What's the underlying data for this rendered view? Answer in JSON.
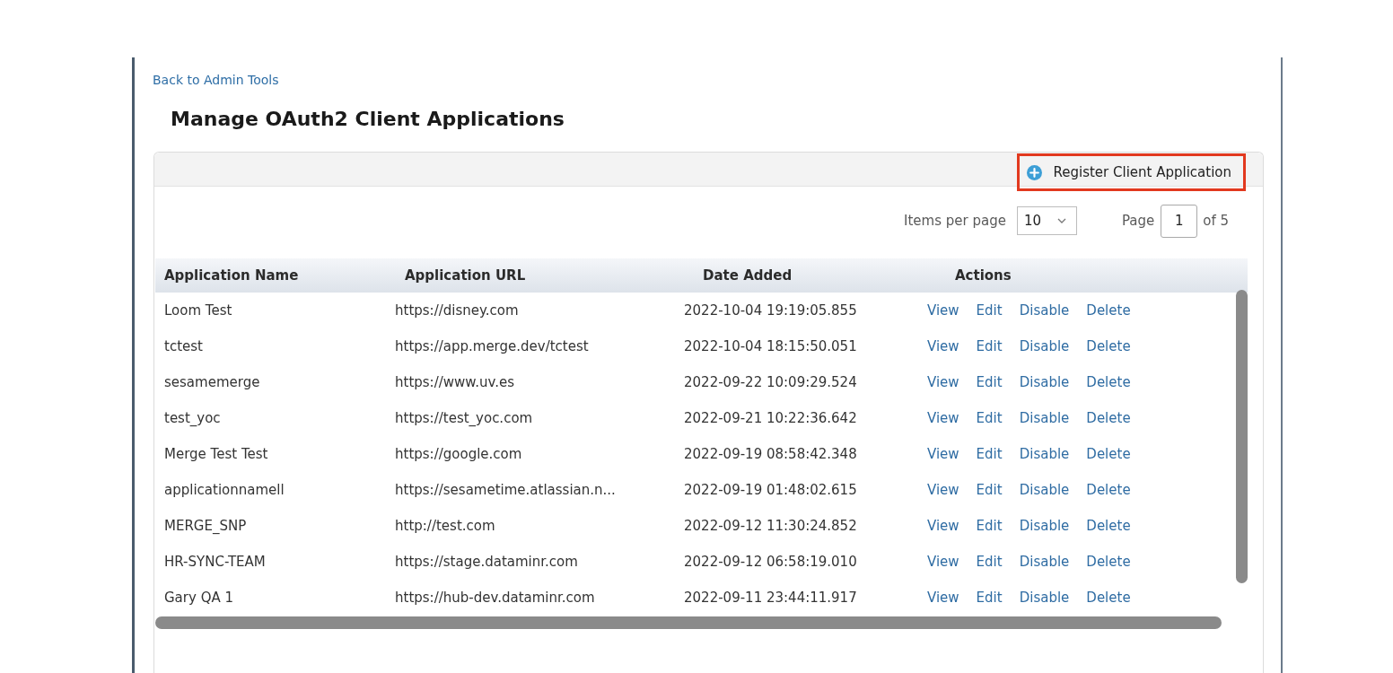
{
  "back_link": "Back to Admin Tools",
  "title": "Manage OAuth2 Client Applications",
  "toolbar": {
    "register_button": {
      "label": "Register Client Application",
      "highlighted": true
    }
  },
  "pagination": {
    "items_per_page_label": "Items per page",
    "items_per_page": "10",
    "page_label": "Page",
    "page": "1",
    "page_total": "of 5"
  },
  "table": {
    "columns": [
      "Application Name",
      "Application URL",
      "Date Added",
      "Actions"
    ],
    "rows": [
      {
        "name": "Loom Test",
        "url": "https://disney.com",
        "date_added": "2022-10-04 19:19:05.855",
        "actions": [
          "View",
          "Edit",
          "Disable",
          "Delete"
        ]
      },
      {
        "name": "tctest",
        "url": "https://app.merge.dev/tctest",
        "date_added": "2022-10-04 18:15:50.051",
        "actions": [
          "View",
          "Edit",
          "Disable",
          "Delete"
        ]
      },
      {
        "name": "sesamemerge",
        "url": "https://www.uv.es",
        "date_added": "2022-09-22 10:09:29.524",
        "actions": [
          "View",
          "Edit",
          "Disable",
          "Delete"
        ]
      },
      {
        "name": "test_yoc",
        "url": "https://test_yoc.com",
        "date_added": "2022-09-21 10:22:36.642",
        "actions": [
          "View",
          "Edit",
          "Disable",
          "Delete"
        ]
      },
      {
        "name": "Merge Test Test",
        "url": "https://google.com",
        "date_added": "2022-09-19 08:58:42.348",
        "actions": [
          "View",
          "Edit",
          "Disable",
          "Delete"
        ]
      },
      {
        "name": "applicationnamell",
        "url": "https://sesametime.atlassian.n...",
        "date_added": "2022-09-19 01:48:02.615",
        "actions": [
          "View",
          "Edit",
          "Disable",
          "Delete"
        ]
      },
      {
        "name": "MERGE_SNP",
        "url": "http://test.com",
        "date_added": "2022-09-12 11:30:24.852",
        "actions": [
          "View",
          "Edit",
          "Disable",
          "Delete"
        ]
      },
      {
        "name": "HR-SYNC-TEAM",
        "url": "https://stage.dataminr.com",
        "date_added": "2022-09-12 06:58:19.010",
        "actions": [
          "View",
          "Edit",
          "Disable",
          "Delete"
        ]
      },
      {
        "name": "Gary QA 1",
        "url": "https://hub-dev.dataminr.com",
        "date_added": "2022-09-11 23:44:11.917",
        "actions": [
          "View",
          "Edit",
          "Disable",
          "Delete"
        ]
      }
    ]
  }
}
